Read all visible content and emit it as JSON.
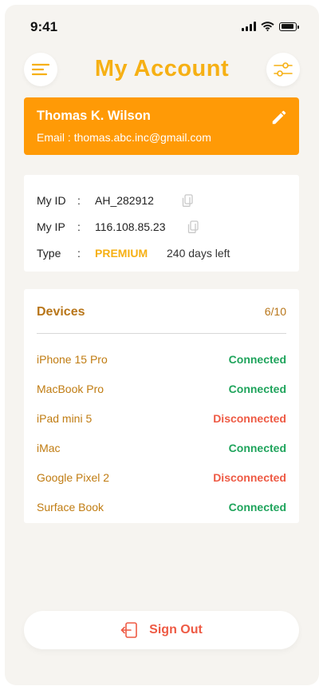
{
  "status_bar": {
    "time": "9:41"
  },
  "header": {
    "title": "My Account"
  },
  "profile": {
    "name": "Thomas K. Wilson",
    "email_label": "Email :",
    "email": "thomas.abc.inc@gmail.com"
  },
  "account_info": {
    "id_label": "My ID",
    "id_value": "AH_282912",
    "ip_label": "My IP",
    "ip_value": "116.108.85.23",
    "type_label": "Type",
    "type_value": "PREMIUM",
    "days_left": "240 days left",
    "separator": ":"
  },
  "devices": {
    "title": "Devices",
    "count": "6/10",
    "items": [
      {
        "name": "iPhone 15 Pro",
        "status": "Connected"
      },
      {
        "name": "MacBook Pro",
        "status": "Connected"
      },
      {
        "name": "iPad mini 5",
        "status": "Disconnected"
      },
      {
        "name": "iMac",
        "status": "Connected"
      },
      {
        "name": "Google Pixel 2",
        "status": "Disconnected"
      },
      {
        "name": "Surface Book",
        "status": "Connected"
      }
    ]
  },
  "sign_out": {
    "label": "Sign Out"
  },
  "colors": {
    "accent": "#f6b014",
    "profile_card": "#ff9a06",
    "connected": "#1fa45c",
    "disconnected": "#ee5a44",
    "device_text": "#c07c12"
  },
  "icons": [
    "signal-icon",
    "wifi-icon",
    "battery-icon",
    "menu-icon",
    "filter-icon",
    "edit-icon",
    "copy-icon",
    "sign-out-icon"
  ]
}
